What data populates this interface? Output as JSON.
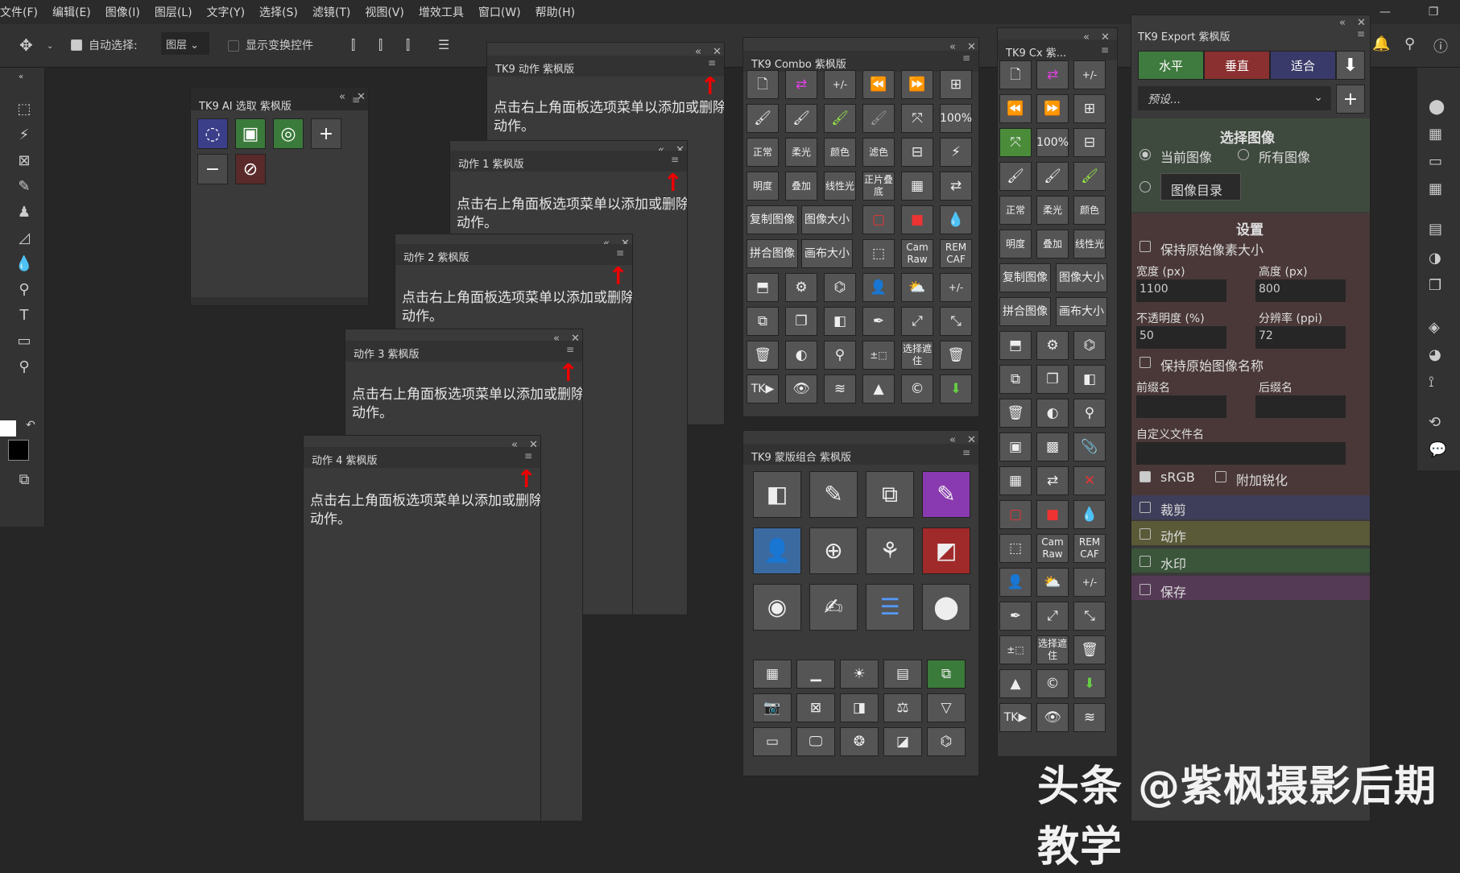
{
  "menu": [
    "文件(F)",
    "编辑(E)",
    "图像(I)",
    "图层(L)",
    "文字(Y)",
    "选择(S)",
    "滤镜(T)",
    "视图(V)",
    "增效工具",
    "窗口(W)",
    "帮助(H)"
  ],
  "options": {
    "auto_select": "自动选择:",
    "layer_dropdown": "图层",
    "show_transform": "显示变换控件"
  },
  "ai_panel": {
    "title": "TK9 AI 选取 紫枫版"
  },
  "action_panels": [
    {
      "title": "TK9 动作 紫枫版",
      "msg": "点击右上角面板选项菜单以添加或删除动作。"
    },
    {
      "title": "动作 1 紫枫版",
      "msg": "点击右上角面板选项菜单以添加或删除动作。"
    },
    {
      "title": "动作 2 紫枫版",
      "msg": "点击右上角面板选项菜单以添加或删除动作。"
    },
    {
      "title": "动作 3 紫枫版",
      "msg": "点击右上角面板选项菜单以添加或删除动作。"
    },
    {
      "title": "动作 4 紫枫版",
      "msg": "点击右上角面板选项菜单以添加或删除动作。"
    }
  ],
  "combo": {
    "title": "TK9 Combo 紫枫版",
    "zoom": "100%",
    "blend1": [
      "正常",
      "柔光",
      "颜色",
      "滤色"
    ],
    "blend2": [
      "明度",
      "叠加",
      "线性光",
      "正片叠底"
    ],
    "copy_image": "复制图像",
    "image_size": "图像大小",
    "flatten": "拼合图像",
    "canvas_size": "画布大小",
    "cam_raw": "Cam Raw",
    "rem_caf": "REM CAF",
    "select_mask": "选择遮住",
    "tk": "TK▶"
  },
  "mask_combo": {
    "title": "TK9 蒙版组合 紫枫版"
  },
  "cx": {
    "title": "TK9 Cx 紫...",
    "zoom": "100%"
  },
  "export": {
    "title": "TK9 Export 紫枫版",
    "btn_h": "水平",
    "btn_v": "垂直",
    "btn_fit": "适合",
    "preset": "预设...",
    "select_title": "选择图像",
    "cur": "当前图像",
    "all": "所有图像",
    "dir": "图像目录",
    "settings": "设置",
    "keep_px": "保持原始像素大小",
    "w_lbl": "宽度 (px)",
    "h_lbl": "高度 (px)",
    "w_val": "1100",
    "h_val": "800",
    "op_lbl": "不透明度 (%)",
    "res_lbl": "分辨率 (ppi)",
    "op_val": "50",
    "res_val": "72",
    "keep_name": "保持原始图像名称",
    "prefix": "前缀名",
    "suffix": "后缀名",
    "custom_name": "自定义文件名",
    "srgb": "sRGB",
    "sharpen": "附加锐化",
    "crop": "裁剪",
    "action": "动作",
    "watermark": "水印",
    "save": "保存"
  },
  "watermark_text": "头条 @紫枫摄影后期教学"
}
